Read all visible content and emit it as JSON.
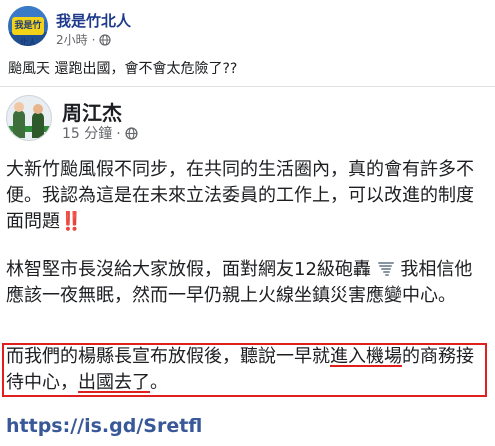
{
  "outer_post": {
    "author": "我是竹北人",
    "avatar_badge": "我是竹北人",
    "time": "2小時",
    "privacy_icon": "globe-icon",
    "text": "颱風天 還跑出國，會不會太危險了??"
  },
  "shared_post": {
    "author": "周江杰",
    "time": "15 分鐘",
    "privacy_icon": "globe-icon",
    "paragraph1": "大新竹颱風假不同步，在共同的生活圈內，真的會有許多不便。我認為這是在未來立法委員的工作上，可以改進的制度面問題",
    "paragraph1_emoji": "‼️",
    "paragraph2_part1": "林智堅市長沒給大家放假，面對網友12級砲轟",
    "paragraph2_emoji": "🌪",
    "paragraph2_part2": "我相信他應該一夜無眠，然而一早仍親上火線坐鎮災害應變中心。",
    "highlight_part1": "而我們的楊縣長宣布放假後，聽說一早就",
    "highlight_underlined1": "進入機場",
    "highlight_part2": "的商務接待中心，",
    "highlight_underlined2": "出國去了",
    "highlight_end": "。",
    "link": "https://is.gd/Sretfl"
  },
  "colors": {
    "highlight_box": "#e0201d",
    "link": "#385898",
    "outer_author": "#1d3a8c"
  }
}
